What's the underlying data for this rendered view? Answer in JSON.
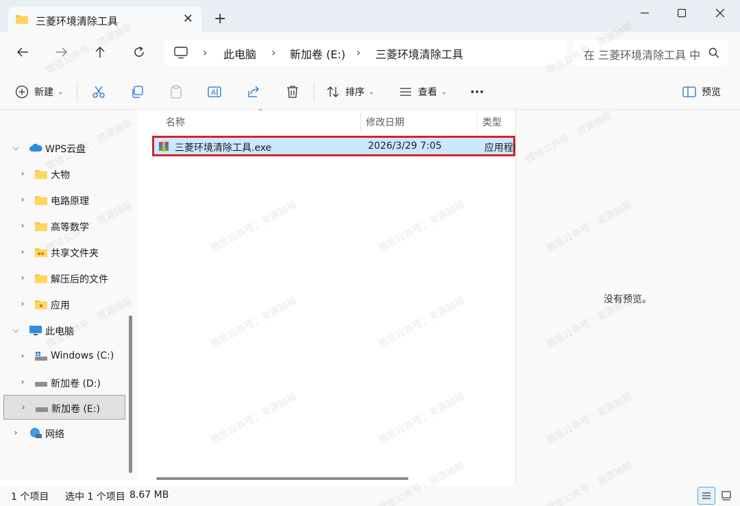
{
  "window": {
    "tab_title": "三菱环境清除工具",
    "tab_close": "✕",
    "new_tab": "+",
    "min": "—",
    "max": "☐",
    "close": "✕"
  },
  "nav": {
    "back": "←",
    "forward": "→",
    "up": "↑",
    "refresh": "↻",
    "breadcrumbs": [
      "此电脑",
      "新加卷 (E:)",
      "三菱环境清除工具"
    ],
    "separator": "›",
    "search_placeholder": "在 三菱环境清除工具 中搜索"
  },
  "commands": {
    "new_label": "新建",
    "sort_label": "排序",
    "view_label": "查看",
    "more": "···",
    "preview_label": "预览"
  },
  "sidebar": {
    "items": [
      {
        "label": "WPS云盘",
        "arrow": "⌵",
        "icon": "cloud-icon"
      },
      {
        "label": "大物",
        "arrow": "›",
        "icon": "folder-icon"
      },
      {
        "label": "电路原理",
        "arrow": "›",
        "icon": "folder-icon"
      },
      {
        "label": "高等数学",
        "arrow": "›",
        "icon": "folder-icon"
      },
      {
        "label": "共享文件夹",
        "arrow": "›",
        "icon": "shared-folder-icon"
      },
      {
        "label": "解压后的文件",
        "arrow": "›",
        "icon": "folder-icon"
      },
      {
        "label": "应用",
        "arrow": "›",
        "icon": "app-folder-icon"
      },
      {
        "label": "此电脑",
        "arrow": "⌵",
        "icon": "computer-icon"
      },
      {
        "label": "Windows (C:)",
        "arrow": "›",
        "icon": "drive-icon"
      },
      {
        "label": "新加卷 (D:)",
        "arrow": "›",
        "icon": "drive-icon"
      },
      {
        "label": "新加卷 (E:)",
        "arrow": "›",
        "icon": "drive-icon"
      },
      {
        "label": "网络",
        "arrow": "›",
        "icon": "network-icon"
      }
    ]
  },
  "columns": {
    "name": "名称",
    "date": "修改日期",
    "type": "类型",
    "sort_caret": "^"
  },
  "files": [
    {
      "name": "三菱环境清除工具.exe",
      "date": "2026/3/29 7:05",
      "type": "应用程序",
      "icon": "winrar-exe-icon"
    }
  ],
  "preview": {
    "message": "没有预览。"
  },
  "status": {
    "count": "1 个项目",
    "selected": "选中 1 个项目",
    "size": "8.67 MB"
  },
  "watermark": "微信公共号：资源抽屉",
  "colors": {
    "selection": "#cce8ff",
    "highlight_border": "#d2232a",
    "folder": "#f6c844"
  }
}
